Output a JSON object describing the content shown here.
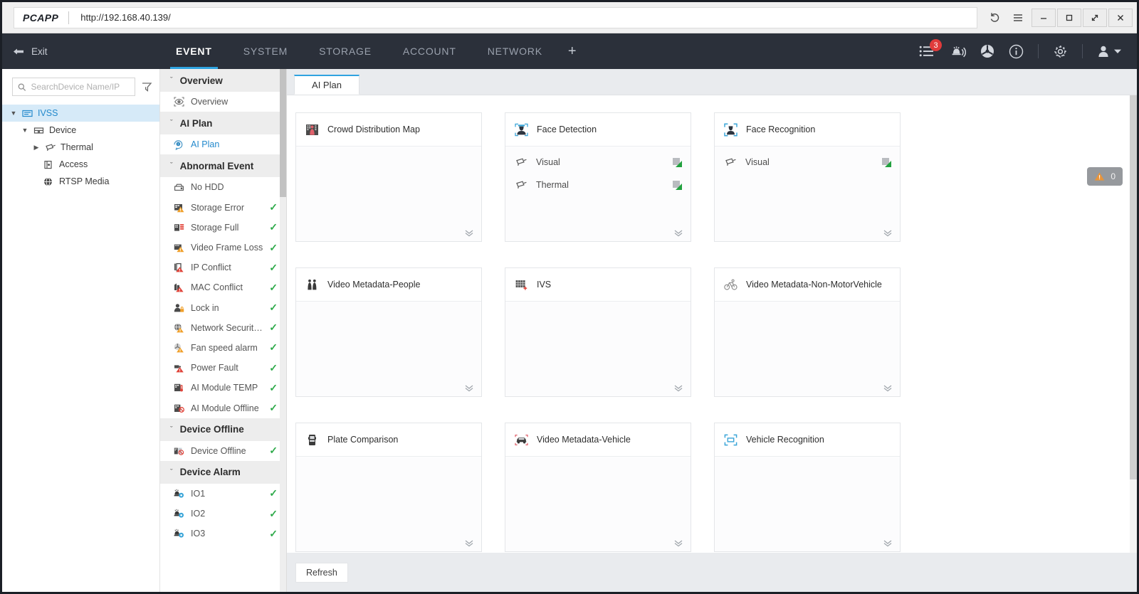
{
  "window": {
    "brand": "PCAPP",
    "url": "http://192.168.40.139/",
    "history_icon": "history-refresh-icon",
    "menu_icon": "hamburger-menu-icon",
    "minimize_label": "–",
    "maximize_label": "□",
    "restore_label": "⤡",
    "close_label": "✕"
  },
  "topnav": {
    "exit_label": "Exit",
    "tabs": [
      {
        "label": "EVENT",
        "active": true
      },
      {
        "label": "SYSTEM",
        "active": false
      },
      {
        "label": "STORAGE",
        "active": false
      },
      {
        "label": "ACCOUNT",
        "active": false
      },
      {
        "label": "NETWORK",
        "active": false
      }
    ],
    "add_tab_label": "+",
    "right_icons": [
      {
        "name": "task-list-icon",
        "badge": "3"
      },
      {
        "name": "alarm-bell-icon",
        "badge": ""
      },
      {
        "name": "fan-status-icon",
        "badge": ""
      },
      {
        "name": "info-icon",
        "badge": ""
      },
      {
        "name": "settings-gear-icon",
        "badge": ""
      }
    ],
    "user_icon": "user-account-icon"
  },
  "device_panel": {
    "search_placeholder": "SearchDevice Name/IP",
    "search_value": "",
    "filter_icon": "filter-funnel-icon",
    "tree": [
      {
        "label": "IVSS",
        "level": 0,
        "icon": "nvr-device-icon",
        "caret": "▼",
        "selected": true
      },
      {
        "label": "Device",
        "level": 1,
        "icon": "device-group-icon",
        "caret": "▼",
        "selected": false
      },
      {
        "label": "Thermal",
        "level": 2,
        "icon": "camera-icon",
        "caret": "▶",
        "selected": false
      },
      {
        "label": "Access",
        "level": 1,
        "icon": "access-control-icon",
        "caret": "",
        "selected": false
      },
      {
        "label": "RTSP Media",
        "level": 1,
        "icon": "rtsp-globe-icon",
        "caret": "",
        "selected": false
      }
    ]
  },
  "nav_panel": {
    "groups": [
      {
        "title": "Overview",
        "chevron": "ˇ",
        "items": [
          {
            "label": "Overview",
            "icon": "overview-eye-icon",
            "check": false,
            "active": false
          }
        ]
      },
      {
        "title": "AI Plan",
        "chevron": "ˇ",
        "items": [
          {
            "label": "AI Plan",
            "icon": "ai-plan-icon",
            "check": false,
            "active": true
          }
        ]
      },
      {
        "title": "Abnormal Event",
        "chevron": "ˇ",
        "items": [
          {
            "label": "No HDD",
            "icon": "no-hdd-icon",
            "check": false,
            "active": false
          },
          {
            "label": "Storage Error",
            "icon": "storage-error-icon",
            "check": true,
            "active": false
          },
          {
            "label": "Storage Full",
            "icon": "storage-full-icon",
            "check": true,
            "active": false
          },
          {
            "label": "Video Frame Loss",
            "icon": "video-frame-loss-icon",
            "check": true,
            "active": false
          },
          {
            "label": "IP Conflict",
            "icon": "ip-conflict-icon",
            "check": true,
            "active": false
          },
          {
            "label": "MAC Conflict",
            "icon": "mac-conflict-icon",
            "check": true,
            "active": false
          },
          {
            "label": "Lock in",
            "icon": "lock-in-icon",
            "check": true,
            "active": false
          },
          {
            "label": "Network Security Ex...",
            "icon": "network-security-icon",
            "check": true,
            "active": false
          },
          {
            "label": "Fan speed alarm",
            "icon": "fan-speed-alarm-icon",
            "check": true,
            "active": false
          },
          {
            "label": "Power Fault",
            "icon": "power-fault-icon",
            "check": true,
            "active": false
          },
          {
            "label": "AI Module TEMP",
            "icon": "ai-module-temp-icon",
            "check": true,
            "active": false
          },
          {
            "label": "AI Module Offline",
            "icon": "ai-module-offline-icon",
            "check": true,
            "active": false
          }
        ]
      },
      {
        "title": "Device Offline",
        "chevron": "ˇ",
        "items": [
          {
            "label": "Device Offline",
            "icon": "device-offline-icon",
            "check": true,
            "active": false
          }
        ]
      },
      {
        "title": "Device Alarm",
        "chevron": "ˇ",
        "items": [
          {
            "label": "IO1",
            "icon": "io-alarm-icon",
            "check": true,
            "active": false
          },
          {
            "label": "IO2",
            "icon": "io-alarm-icon",
            "check": true,
            "active": false
          },
          {
            "label": "IO3",
            "icon": "io-alarm-icon",
            "check": true,
            "active": false
          }
        ]
      }
    ]
  },
  "main": {
    "tabs": [
      {
        "label": "AI Plan",
        "active": true
      }
    ],
    "expand_glyph": "ˇ",
    "warning": {
      "icon": "warning-triangle-icon",
      "count": "0"
    },
    "refresh_label": "Refresh",
    "cards": [
      {
        "title": "Crowd Distribution Map",
        "icon": "crowd-distribution-map-icon",
        "channels": []
      },
      {
        "title": "Face Detection",
        "icon": "face-detection-icon",
        "channels": [
          {
            "name": "Visual",
            "icon": "camera-icon",
            "status": "enabled"
          },
          {
            "name": "Thermal",
            "icon": "camera-icon",
            "status": "enabled"
          }
        ]
      },
      {
        "title": "Face Recognition",
        "icon": "face-recognition-icon",
        "channels": [
          {
            "name": "Visual",
            "icon": "camera-icon",
            "status": "enabled"
          }
        ]
      },
      {
        "title": "Video Metadata-People",
        "icon": "video-metadata-people-icon",
        "channels": []
      },
      {
        "title": "IVS",
        "icon": "ivs-icon",
        "channels": []
      },
      {
        "title": "Video Metadata-Non-MotorVehicle",
        "icon": "video-metadata-non-motor-icon",
        "channels": []
      },
      {
        "title": "Plate Comparison",
        "icon": "plate-comparison-icon",
        "channels": []
      },
      {
        "title": "Video Metadata-Vehicle",
        "icon": "video-metadata-vehicle-icon",
        "channels": []
      },
      {
        "title": "Vehicle Recognition",
        "icon": "vehicle-recognition-icon",
        "channels": []
      }
    ]
  },
  "colors": {
    "accent": "#2fa3e0",
    "navbg": "#2b303a",
    "check": "#2eaa4a",
    "badge": "#e03b3b",
    "warning": "#e8943a"
  }
}
